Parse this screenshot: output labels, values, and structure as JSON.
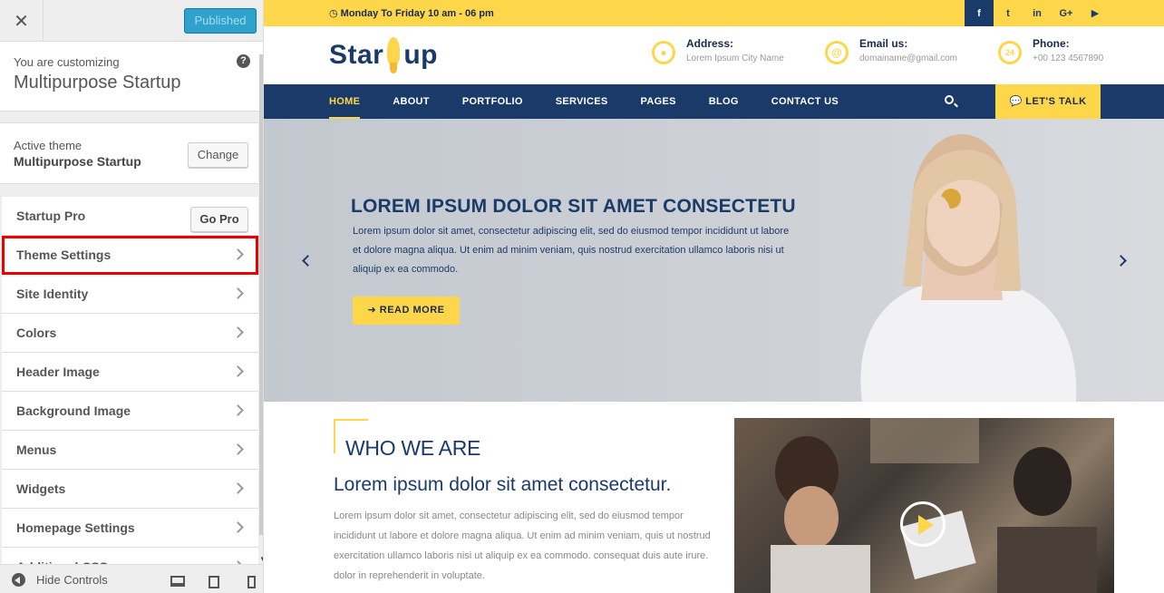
{
  "sidebar": {
    "close_icon": "close-icon",
    "publish_label": "Published",
    "customizing_label": "You are customizing",
    "site_name": "Multipurpose Startup",
    "help_glyph": "?",
    "active_theme_label": "Active theme",
    "active_theme_name": "Multipurpose Startup",
    "change_label": "Change",
    "startup_pro_label": "Startup Pro",
    "go_pro_label": "Go Pro",
    "items": [
      {
        "label": "Theme Settings"
      },
      {
        "label": "Site Identity"
      },
      {
        "label": "Colors"
      },
      {
        "label": "Header Image"
      },
      {
        "label": "Background Image"
      },
      {
        "label": "Menus"
      },
      {
        "label": "Widgets"
      },
      {
        "label": "Homepage Settings"
      },
      {
        "label": "Additional CSS"
      }
    ],
    "hide_controls_label": "Hide Controls"
  },
  "topbar": {
    "hours": "Monday To Friday  10 am - 06 pm",
    "social": [
      "f",
      "t",
      "in",
      "G+",
      "▶"
    ]
  },
  "header": {
    "logo_left": "Star",
    "logo_right": "up",
    "address_title": "Address:",
    "address_value": "Lorem Ipsum City Name",
    "email_title": "Email us:",
    "email_value": "domainame@gmail.com",
    "phone_title": "Phone:",
    "phone_value": "+00 123 4567890",
    "phone_badge": "24"
  },
  "nav": {
    "items": [
      "HOME",
      "ABOUT",
      "PORTFOLIO",
      "SERVICES",
      "PAGES",
      "BLOG",
      "CONTACT US"
    ],
    "talk_label": "LET'S TALK"
  },
  "hero": {
    "title": "LOREM IPSUM DOLOR SIT AMET CONSECTETU",
    "text": "Lorem ipsum dolor sit amet, consectetur adipiscing elit, sed do eiusmod tempor incididunt ut labore et dolore magna aliqua. Ut enim ad minim veniam, quis nostrud exercitation ullamco laboris nisi ut aliquip ex ea commodo.",
    "button_label": "READ MORE"
  },
  "about": {
    "title": "WHO WE ARE",
    "subtitle": "Lorem ipsum dolor sit amet consectetur.",
    "text": "Lorem ipsum dolor sit amet, consectetur adipiscing elit, sed do eiusmod tempor incididunt ut labore et dolore magna aliqua. Ut enim ad minim veniam, quis ut nostrud exercitation ullamco laboris nisi ut aliquip ex ea commodo. consequat duis aute irure. dolor in reprehenderit in voluptate."
  },
  "colors": {
    "accent": "#fed64a",
    "navy": "#1a3b6a",
    "publish": "#2ea2cc",
    "highlight": "#ee0000"
  }
}
